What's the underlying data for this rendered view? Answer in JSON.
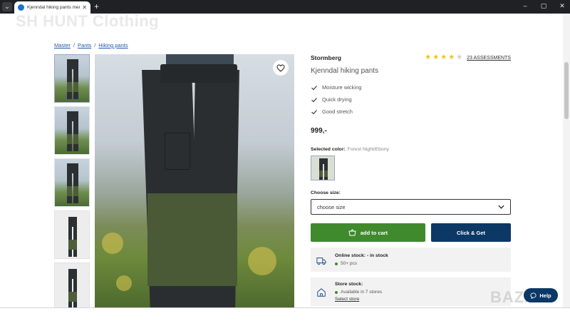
{
  "browser": {
    "tab_title": "Kjenndal hiking pants men - gr...",
    "new_tab": "+",
    "menu": "⌄",
    "controls": [
      "–",
      "▢",
      "✕"
    ]
  },
  "watermark": "SH HUNT Clothing",
  "breadcrumb": {
    "items": [
      "Master",
      "Pants",
      "Hiking pants"
    ],
    "separator": "/"
  },
  "product": {
    "brand": "Stormberg",
    "name": "Kjenndal hiking pants",
    "rating": {
      "stars": 4,
      "max": 5,
      "link": "23 ASSESSMENTS"
    },
    "features": [
      "Moisture wicking",
      "Quick drying",
      "Good stretch"
    ],
    "price": "999,-",
    "selected_color_label": "Selected color:",
    "selected_color_value": "Forest Night/Ebony",
    "choose_size_label": "Choose size:",
    "size_placeholder": "choose size"
  },
  "actions": {
    "add_to_cart": "add to cart",
    "click_get": "Click & Get"
  },
  "stock": {
    "online_title": "Online stock: - in stock",
    "online_qty": "50+ pcs",
    "store_title": "Store stock:",
    "store_avail": "Available in 7 stores",
    "select_store": "Select store"
  },
  "help": "Help",
  "corner_mark": "BAZAR",
  "colors": {
    "cart_green": "#3f8a2c",
    "click_navy": "#0c3866",
    "star_yellow": "#f1c21b",
    "link_blue": "#1f5aa6"
  },
  "icons": [
    "chevron-down-icon",
    "heart-icon",
    "check-icon",
    "cart-icon",
    "truck-icon",
    "store-icon",
    "chat-icon"
  ]
}
